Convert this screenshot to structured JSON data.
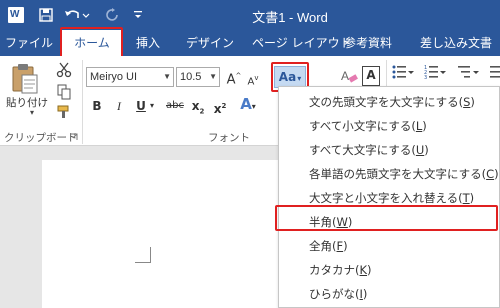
{
  "window": {
    "title": "文書1 - Word",
    "app_icon": "W"
  },
  "quick_access": {
    "save_icon": "floppy-icon",
    "undo_icon": "undo-icon",
    "redo_icon": "redo-icon"
  },
  "tabs": {
    "file": "ファイル",
    "home": "ホーム",
    "insert": "挿入",
    "design": "デザイン",
    "layout": "ページ レイアウト",
    "references": "参考資料",
    "mailings": "差し込み文書"
  },
  "ribbon": {
    "paste_label": "貼り付け",
    "clipboard_group": "クリップボード",
    "font_group": "フォント",
    "font_name": "Meiryo UI",
    "font_size": "10.5",
    "grow_font": "A",
    "shrink_font": "A",
    "change_case": "Aa",
    "clear_format": "A",
    "char_border": "A",
    "bold": "B",
    "italic": "I",
    "underline": "U",
    "strikethrough": "abc",
    "subscript": "x",
    "superscript": "x",
    "subscript_index": "2",
    "superscript_index": "2",
    "text_effects": "A"
  },
  "menu": {
    "items": [
      {
        "text": "文の先頭文字を大文字にする(",
        "key": "S",
        "end": ")"
      },
      {
        "text": "すべて小文字にする(",
        "key": "L",
        "end": ")"
      },
      {
        "text": "すべて大文字にする(",
        "key": "U",
        "end": ")"
      },
      {
        "text": "各単語の先頭文字を大文字にする(",
        "key": "C",
        "end": ")"
      },
      {
        "text": "大文字と小文字を入れ替える(",
        "key": "T",
        "end": ")"
      },
      {
        "text": "半角(",
        "key": "W",
        "end": ")"
      },
      {
        "text": "全角(",
        "key": "F",
        "end": ")"
      },
      {
        "text": "カタカナ(",
        "key": "K",
        "end": ")"
      },
      {
        "text": "ひらがな(",
        "key": "I",
        "end": ")"
      }
    ]
  },
  "colors": {
    "brand": "#2b579a",
    "highlight": "#e02020"
  }
}
